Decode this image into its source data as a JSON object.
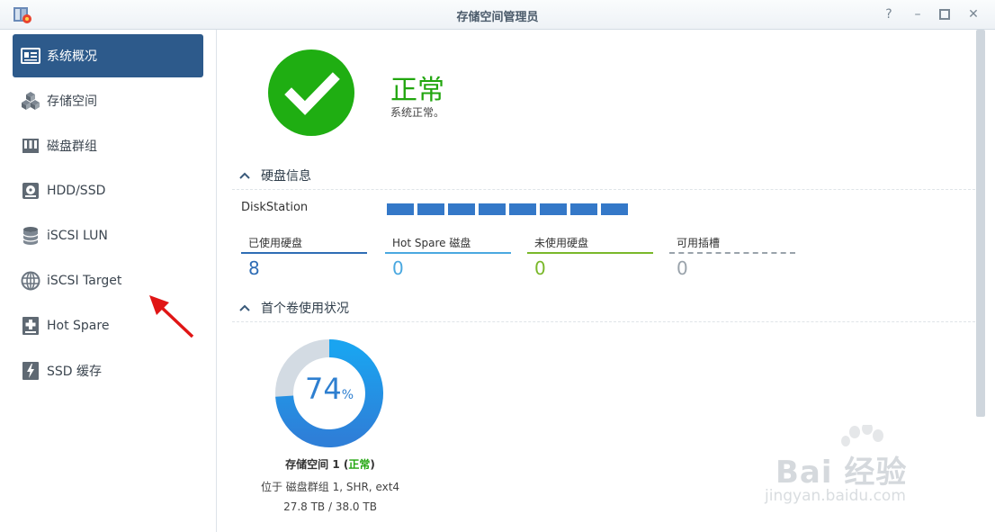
{
  "window": {
    "title": "存储空间管理员",
    "help_icon": "help-icon",
    "min_icon": "minimize-icon",
    "max_icon": "maximize-icon",
    "close_icon": "close-icon"
  },
  "sidebar": {
    "items": [
      {
        "label": "系统概况",
        "icon": "overview-icon",
        "active": true
      },
      {
        "label": "存储空间",
        "icon": "cubes-icon",
        "active": false
      },
      {
        "label": "磁盘群组",
        "icon": "disk-group-icon",
        "active": false
      },
      {
        "label": "HDD/SSD",
        "icon": "hdd-icon",
        "active": false
      },
      {
        "label": "iSCSI LUN",
        "icon": "database-icon",
        "active": false
      },
      {
        "label": "iSCSI Target",
        "icon": "globe-icon",
        "active": false
      },
      {
        "label": "Hot Spare",
        "icon": "plus-drive-icon",
        "active": false
      },
      {
        "label": "SSD 缓存",
        "icon": "lightning-drive-icon",
        "active": false
      }
    ]
  },
  "status": {
    "title": "正常",
    "subtitle": "系统正常。",
    "color": "#1fae12"
  },
  "disk_info": {
    "section_label": "硬盘信息",
    "device_name": "DiskStation",
    "disk_count": 8,
    "disk_color": "#3478c8",
    "stats": [
      {
        "label": "已使用硬盘",
        "value": "8",
        "color": "#2f6db5"
      },
      {
        "label": "Hot Spare 磁盘",
        "value": "0",
        "color": "#4aa8e0"
      },
      {
        "label": "未使用硬盘",
        "value": "0",
        "color": "#7ab82a"
      },
      {
        "label": "可用插槽",
        "value": "0",
        "color": "#9aa3ab"
      }
    ]
  },
  "volume": {
    "section_label": "首个卷使用状况",
    "percent": "74",
    "percent_sign": "%",
    "usage_fraction": 0.74,
    "name": "存储空间 1",
    "status_open": " (",
    "status": "正常",
    "status_close": ")",
    "description": "位于 磁盘群组 1, SHR, ext4",
    "size": "27.8 TB / 38.0 TB"
  },
  "watermark": {
    "line1": "Bai 经验",
    "line2": "jingyan.baidu.com"
  }
}
